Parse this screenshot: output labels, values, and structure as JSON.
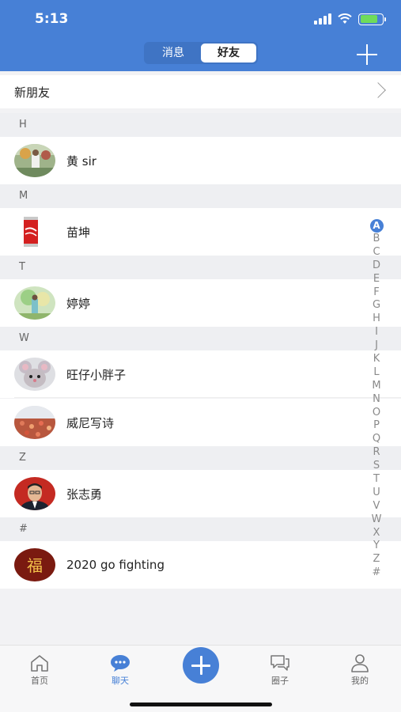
{
  "status": {
    "time": "5:13"
  },
  "header": {
    "tabs": [
      {
        "label": "消息",
        "active": false
      },
      {
        "label": "好友",
        "active": true
      }
    ]
  },
  "new_friends": {
    "label": "新朋友"
  },
  "sections": [
    {
      "letter": "H",
      "contacts": [
        {
          "name": "黄 sir",
          "avatar": "outdoor-photo"
        }
      ]
    },
    {
      "letter": "M",
      "contacts": [
        {
          "name": "苗坤",
          "avatar": "coca-cola-can"
        }
      ]
    },
    {
      "letter": "T",
      "contacts": [
        {
          "name": "婷婷",
          "avatar": "nature-photo"
        }
      ]
    },
    {
      "letter": "W",
      "contacts": [
        {
          "name": "旺仔小胖子",
          "avatar": "cartoon-mouse"
        },
        {
          "name": "威尼写诗",
          "avatar": "tulip-field"
        }
      ]
    },
    {
      "letter": "Z",
      "contacts": [
        {
          "name": "张志勇",
          "avatar": "portrait-man"
        }
      ]
    },
    {
      "letter": "#",
      "contacts": [
        {
          "name": "2020 go fighting",
          "avatar": "fu-character"
        }
      ]
    }
  ],
  "avatar_text": {
    "fu": "福"
  },
  "index_letters": [
    "A",
    "B",
    "C",
    "D",
    "E",
    "F",
    "G",
    "H",
    "I",
    "J",
    "K",
    "L",
    "M",
    "N",
    "O",
    "P",
    "Q",
    "R",
    "S",
    "T",
    "U",
    "V",
    "W",
    "X",
    "Y",
    "Z",
    "#"
  ],
  "index_active": "A",
  "bottom_nav": [
    {
      "label": "首页",
      "icon": "home-icon",
      "active": false
    },
    {
      "label": "聊天",
      "icon": "chat-icon",
      "active": true
    },
    {
      "label": "",
      "icon": "plus-icon",
      "active": false
    },
    {
      "label": "圈子",
      "icon": "comments-icon",
      "active": false
    },
    {
      "label": "我的",
      "icon": "user-icon",
      "active": false
    }
  ],
  "colors": {
    "accent": "#4780d6",
    "section_bg": "#eeeff2",
    "battery": "#6fdc5a"
  }
}
